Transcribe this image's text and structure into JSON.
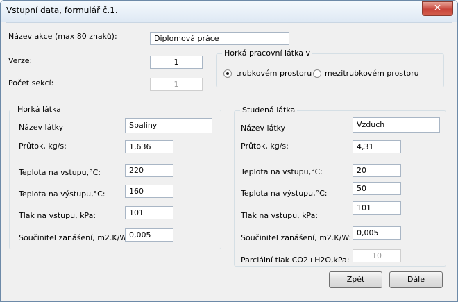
{
  "window": {
    "title": "Vstupní data, formulář č.1.",
    "close_glyph": "✕"
  },
  "general": {
    "project_name_label": "Název akce (max 80 znaků):",
    "project_name_value": "Diplomová práce",
    "version_label": "Verze:",
    "version_value": "1",
    "sections_label": "Počet sekcí:",
    "sections_value": "1"
  },
  "hot_fluid_location": {
    "legend": "Horká pracovní látka v",
    "option_tube": "trubkovém prostoru",
    "option_shell": "mezitrubkovém prostoru",
    "selected": "tube"
  },
  "hot": {
    "legend": "Horká látka",
    "name_label": "Název látky",
    "name_value": "Spaliny",
    "flow_label": "Průtok, kg/s:",
    "flow_value": "1,636",
    "temp_in_label": "Teplota na vstupu,°C:",
    "temp_in_value": "220",
    "temp_out_label": "Teplota na výstupu,°C:",
    "temp_out_value": "160",
    "pressure_label": "Tlak na vstupu, kPa:",
    "pressure_value": "101",
    "fouling_label": "Součinitel zanášení, m2.K/W:",
    "fouling_value": "0,005"
  },
  "cold": {
    "legend": "Studená látka",
    "name_label": "Název látky",
    "name_value": "Vzduch",
    "flow_label": "Průtok, kg/s:",
    "flow_value": "4,31",
    "temp_in_label": "Teplota na vstupu,°C:",
    "temp_in_value": "20",
    "temp_out_label": "Teplota na výstupu,°C:",
    "temp_out_value": "50",
    "pressure_label": "Tlak na vstupu, kPa:",
    "pressure_value": "101",
    "fouling_label": "Součinitel zanášení, m2.K/W:",
    "fouling_value": "0,005",
    "partial_pressure_label": "Parciální tlak CO2+H2O,kPa:",
    "partial_pressure_value": "10"
  },
  "buttons": {
    "back": "Zpět",
    "next": "Dále"
  }
}
